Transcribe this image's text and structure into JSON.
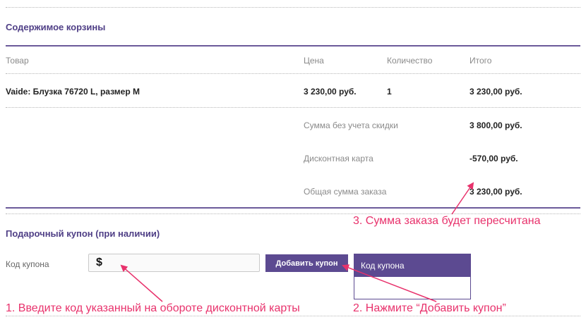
{
  "cart": {
    "title": "Содержимое корзины",
    "columns": [
      "Товар",
      "Цена",
      "Количество",
      "Итого"
    ],
    "rows": [
      {
        "product": "Vaide: Блузка 76720 L, размер M",
        "price": "3 230,00 руб.",
        "qty": "1",
        "total": "3 230,00 руб."
      }
    ],
    "summary": [
      {
        "label": "Сумма без учета скидки",
        "value": "3 800,00 руб."
      },
      {
        "label": "Дисконтная карта",
        "value": "-570,00 руб."
      },
      {
        "label": "Общая сумма заказа",
        "value": "3 230,00 руб."
      }
    ]
  },
  "coupon": {
    "title": "Подарочный купон (при наличии)",
    "field_label": "Код купона",
    "input_value": "$",
    "button_label": "Добавить купон",
    "tooltip_label": "Код купона"
  },
  "annotations": {
    "step1": "1. Введите код указанный на обороте дисконтной карты",
    "step2": "2. Нажмите “Добавить купон”",
    "step3": "3. Сумма заказа будет пересчитана"
  },
  "colors": {
    "accent": "#5c4a91",
    "annotation": "#e8326c"
  }
}
